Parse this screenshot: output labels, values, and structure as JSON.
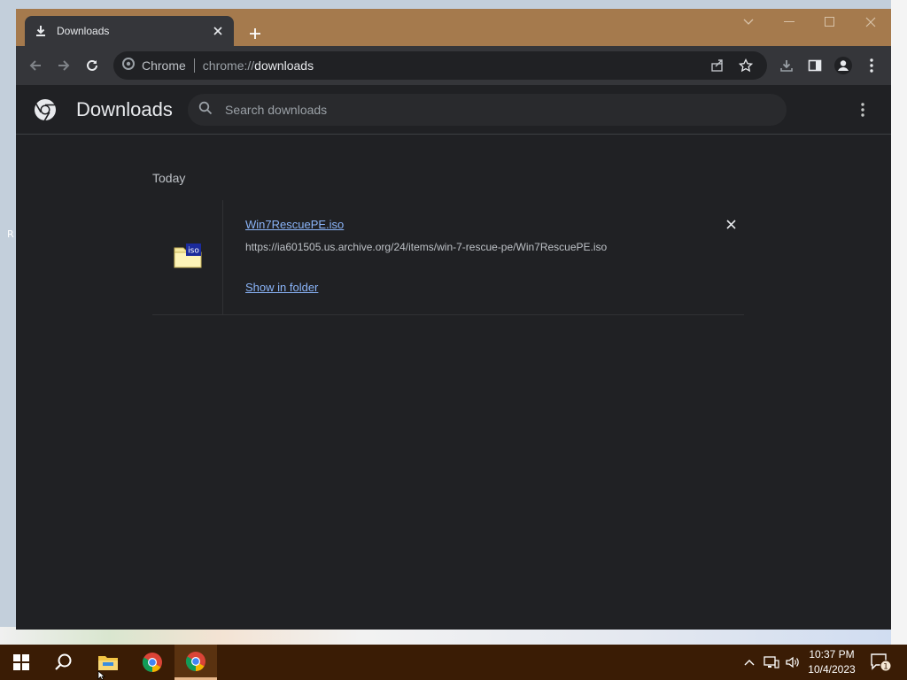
{
  "desktop": {
    "edge_letter": "R"
  },
  "browser": {
    "tab": {
      "title": "Downloads",
      "icon": "download-icon"
    },
    "window_controls": [
      "tab-search-icon",
      "minimize-icon",
      "maximize-icon",
      "close-icon"
    ],
    "omnibox": {
      "chip": "Chrome",
      "scheme": "chrome://",
      "host": "downloads"
    },
    "toolbar_icons": [
      "back-icon",
      "forward-icon",
      "reload-icon",
      "share-icon",
      "bookmark-star-icon",
      "download-icon",
      "side-panel-icon",
      "profile-icon",
      "menu-icon"
    ]
  },
  "downloads_page": {
    "title": "Downloads",
    "search_placeholder": "Search downloads",
    "section_label": "Today",
    "items": [
      {
        "file_name": "Win7RescuePE.iso",
        "url": "https://ia601505.us.archive.org/24/items/win-7-rescue-pe/Win7RescuePE.iso",
        "action": "Show in folder",
        "icon_label": "iso"
      }
    ]
  },
  "taskbar": {
    "items": [
      "start-icon",
      "search-icon",
      "file-explorer-icon",
      "chrome-icon",
      "chrome-icon"
    ],
    "clock": {
      "time": "10:37 PM",
      "date": "10/4/2023"
    },
    "notification_count": "1"
  },
  "colors": {
    "titlebar": "#a57a4d",
    "toolbar": "#35363a",
    "page_bg": "#202124",
    "link": "#8ab4f8",
    "taskbar": "#3a1c05"
  }
}
